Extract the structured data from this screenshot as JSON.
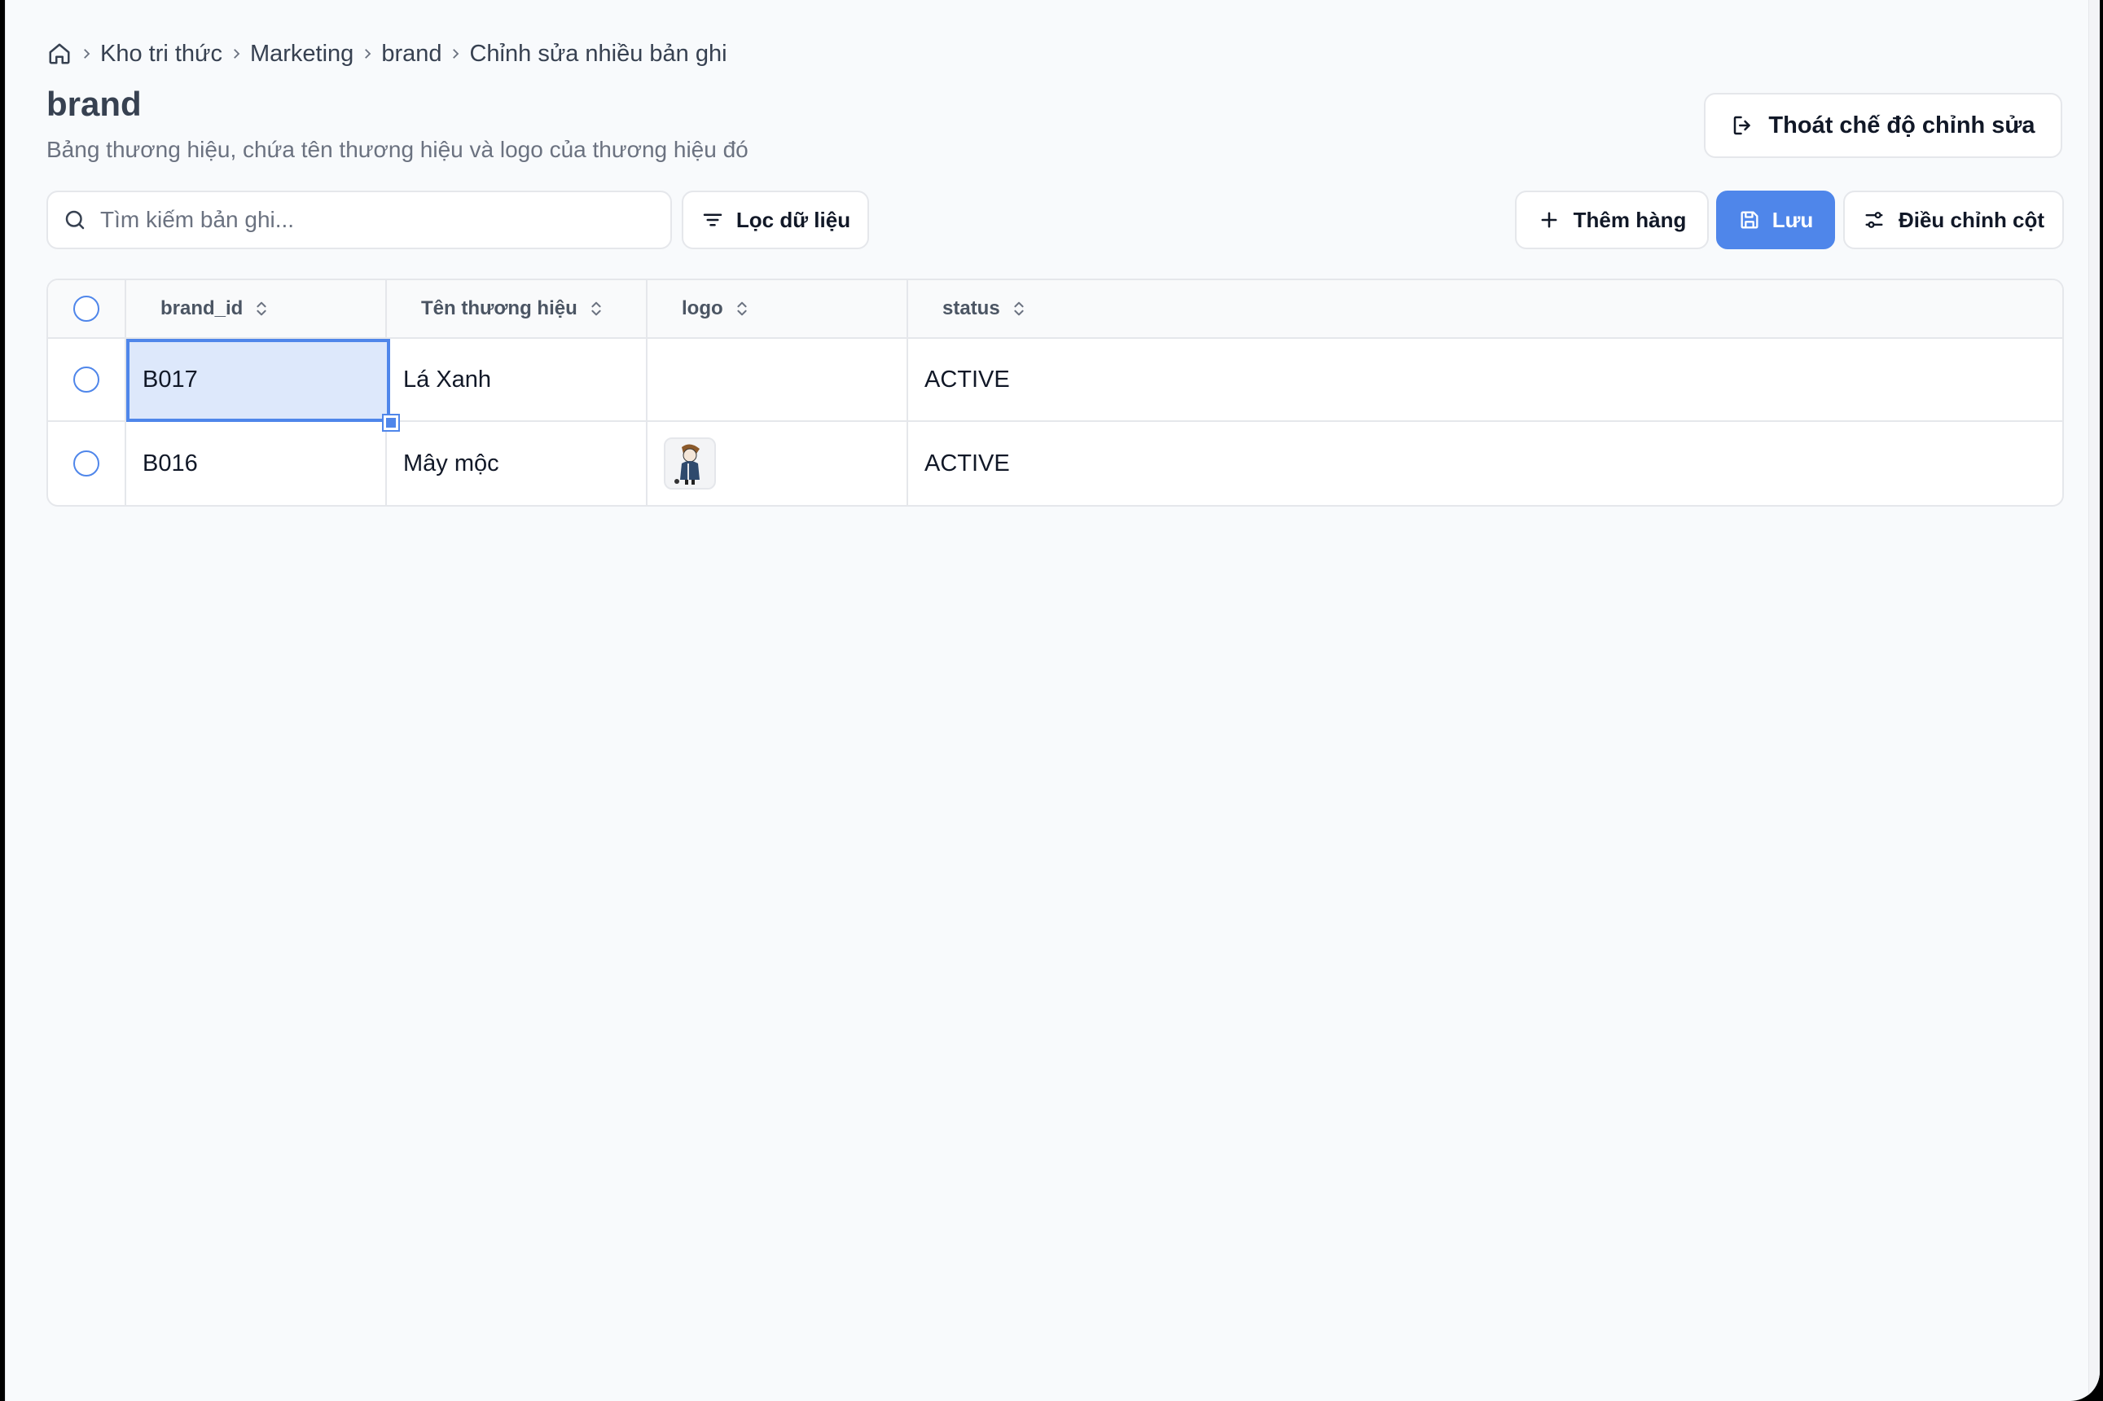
{
  "breadcrumb": {
    "items": [
      "Kho tri thức",
      "Marketing",
      "brand",
      "Chỉnh sửa nhiều bản ghi"
    ]
  },
  "page": {
    "title": "brand",
    "description": "Bảng thương hiệu, chứa tên thương hiệu và logo của thương hiệu đó"
  },
  "actions": {
    "exit_edit": "Thoát chế độ chỉnh sửa",
    "filter": "Lọc dữ liệu",
    "add_row": "Thêm hàng",
    "save": "Lưu",
    "adjust_columns": "Điều chỉnh cột"
  },
  "search": {
    "placeholder": "Tìm kiếm bản ghi...",
    "value": ""
  },
  "table": {
    "columns": [
      "brand_id",
      "Tên thương hiệu",
      "logo",
      "status"
    ],
    "rows": [
      {
        "brand_id": "B017",
        "name": "Lá Xanh",
        "logo": "",
        "status": "ACTIVE"
      },
      {
        "brand_id": "B016",
        "name": "Mây mộc",
        "logo": "brand-logo-image",
        "status": "ACTIVE"
      }
    ]
  },
  "colors": {
    "accent": "#4f86ea",
    "background": "#f8fafc",
    "border": "#e5e7eb"
  }
}
